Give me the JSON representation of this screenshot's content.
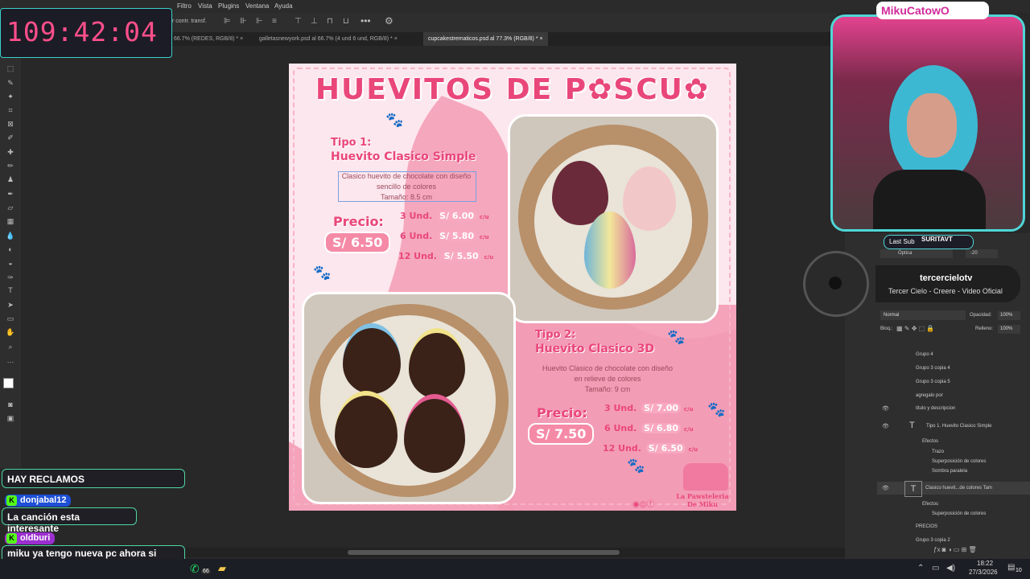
{
  "menu": [
    "Filtro",
    "Vista",
    "Plugins",
    "Ventana",
    "Ayuda"
  ],
  "options": {
    "transform_label": "r contr. transf."
  },
  "tabs": [
    {
      "label": "66.7% (REDES, RGB/8) *"
    },
    {
      "label": "galletasnewyork.psd al 66.7% (4 und  6 und, RGB/8) *"
    },
    {
      "label": "cupcakestrematicos.psd al 77.3% (RGB/8) *",
      "active": true
    }
  ],
  "artboard": {
    "title": "HUEVITOS DE P✿SCU✿",
    "type1": {
      "label_line1": "Tipo 1:",
      "label_line2": "Huevito Clasico Simple",
      "desc_line1": "Clasico huevito de chocolate con diseño",
      "desc_line2": "sencillo de colores",
      "desc_line3": "Tamaño: 8.5 cm",
      "price_label": "Precio:",
      "price": "S/ 6.50",
      "tiers": [
        {
          "qty": "3 Und.",
          "amount": "S/ 6.00",
          "unit": "c/u"
        },
        {
          "qty": "6 Und.",
          "amount": "S/ 5.80",
          "unit": "c/u"
        },
        {
          "qty": "12 Und.",
          "amount": "S/ 5.50",
          "unit": "c/u"
        }
      ]
    },
    "type2": {
      "label_line1": "Tipo 2:",
      "label_line2": "Huevito Clasico 3D",
      "desc_line1": "Huevito Clasico de chocolate con diseño",
      "desc_line2": "en relieve de colores",
      "desc_line3": "Tamaño: 9 cm",
      "price_label": "Precio:",
      "price": "S/ 7.50",
      "tiers": [
        {
          "qty": "3 Und.",
          "amount": "S/ 7.00",
          "unit": "c/u"
        },
        {
          "qty": "6 Und.",
          "amount": "S/ 6.80",
          "unit": "c/u"
        },
        {
          "qty": "12 Und.",
          "amount": "S/ 6.50",
          "unit": "c/u"
        }
      ]
    },
    "brand": "La Pawsteleria De Miku"
  },
  "layers_panel": {
    "blend_mode": "Normal",
    "opacity_label": "Opacidad:",
    "opacity": "100%",
    "lock_label": "Bloq.:",
    "fill_label": "Relleno:",
    "fill": "100%",
    "char_optica": "Óptica",
    "char_value": "-20",
    "layers": [
      {
        "name": "Grupo 4"
      },
      {
        "name": "Grupo 3 copia 4"
      },
      {
        "name": "Grupo 3 copia 5"
      },
      {
        "name": "agregalo por"
      },
      {
        "name": "titulo y descripcion"
      },
      {
        "name": "Tipo 1. Huevito Clasico Simple"
      },
      {
        "name": "Efectos"
      },
      {
        "name": "Trazo"
      },
      {
        "name": "Superposición de colores"
      },
      {
        "name": "Sombra paralela"
      },
      {
        "name": "Clasico huevit...de colores Tam"
      },
      {
        "name": "Efectos"
      },
      {
        "name": "Superposición de colores"
      },
      {
        "name": "PRECIOS"
      },
      {
        "name": "Grupo 3 copia 2"
      }
    ]
  },
  "overlay": {
    "timer": "109:42:04",
    "streamer": "MikuCatowO",
    "last_sub_label": "Last Sub",
    "last_sub_name": "SURITAVT",
    "music_artist": "tercercielotv",
    "music_track": "Tercer Cielo - Creere - Video Oficial"
  },
  "chat": [
    {
      "user": "",
      "text": "HAY RECLAMOS"
    },
    {
      "user": "donjabal12",
      "text": "La canción esta interesante"
    },
    {
      "user": "oldburi",
      "text": "miku ya tengo nueva pc ahora si podre jugar csgo y dota tranquilo"
    }
  ],
  "taskbar": {
    "time": "18:22",
    "date": "27/3/2026",
    "badge": "66",
    "notif": "10"
  }
}
